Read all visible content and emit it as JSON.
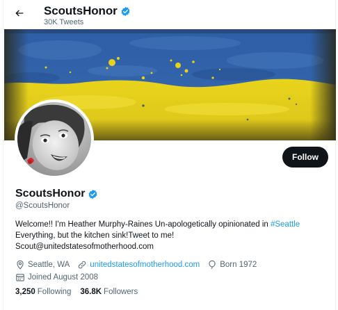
{
  "header": {
    "name": "ScoutsHonor",
    "tweet_count": "30K Tweets"
  },
  "profile": {
    "display_name": "ScoutsHonor",
    "handle": "@ScoutsHonor",
    "follow_label": "Follow",
    "verified": true,
    "bio": {
      "line1_text": "Welcome!! I'm Heather Murphy-Raines Un-apologetically opinionated in ",
      "hashtag": "#Seattle",
      "line2": "Everything, but the kitchen sink!Tweet to me!",
      "line3": " Scout@unitedstatesofmotherhood.com"
    },
    "location": "Seattle, WA",
    "website": "unitedstatesofmotherhood.com",
    "born": "Born 1972",
    "joined": "Joined August 2008",
    "following_count": "3,250",
    "following_label": "Following",
    "followers_count": "36.8K",
    "followers_label": "Followers"
  },
  "colors": {
    "accent": "#1d9bf0",
    "text": "#0f1419",
    "muted": "#536471",
    "banner_blue": "#2f5fa8",
    "banner_yellow": "#e8d21a"
  },
  "icons": [
    "back-arrow-icon",
    "verified-badge-icon",
    "location-icon",
    "link-icon",
    "birthday-balloon-icon",
    "calendar-icon"
  ]
}
